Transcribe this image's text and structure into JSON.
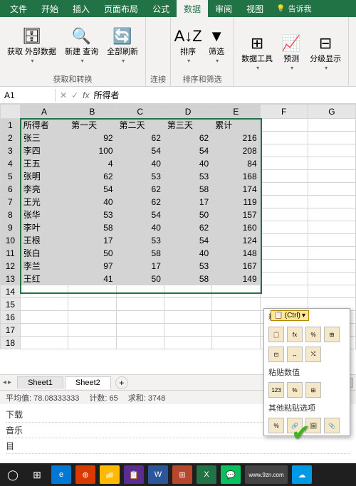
{
  "menubar": {
    "tabs": [
      "文件",
      "开始",
      "插入",
      "页面布局",
      "公式",
      "数据",
      "审阅",
      "视图"
    ],
    "active_index": 5,
    "tellme": "告诉我"
  },
  "ribbon": {
    "groups": [
      {
        "id": "get",
        "label": "获取和转换",
        "items": [
          {
            "icon": "🗄",
            "lbl": "获取\n外部数据"
          },
          {
            "icon": "🔍",
            "lbl": "新建\n查询"
          },
          {
            "icon": "🔄",
            "lbl": "全部刷新"
          }
        ]
      },
      {
        "id": "conn",
        "label": "连接",
        "items": []
      },
      {
        "id": "sort",
        "label": "排序和筛选",
        "items": [
          {
            "icon": "A↓Z",
            "lbl": "排序"
          },
          {
            "icon": "▼",
            "lbl": "筛选"
          }
        ]
      },
      {
        "id": "tools",
        "label": "",
        "items": [
          {
            "icon": "⊞",
            "lbl": "数据工具"
          },
          {
            "icon": "📈",
            "lbl": "预测"
          },
          {
            "icon": "⊟",
            "lbl": "分级显示"
          }
        ]
      }
    ]
  },
  "namebox": {
    "ref": "A1",
    "formula": "所得者"
  },
  "columns": [
    "A",
    "B",
    "C",
    "D",
    "E",
    "F",
    "G"
  ],
  "row_count": 18,
  "selected_cols": 5,
  "selected_rows": 13,
  "chart_data": {
    "type": "table",
    "headers": [
      "所得者",
      "第一天",
      "第二天",
      "第三天",
      "累计"
    ],
    "rows": [
      [
        "张三",
        92,
        62,
        62,
        216
      ],
      [
        "李四",
        100,
        54,
        54,
        208
      ],
      [
        "王五",
        4,
        40,
        40,
        84
      ],
      [
        "张明",
        62,
        53,
        53,
        168
      ],
      [
        "李亮",
        54,
        62,
        58,
        174
      ],
      [
        "王光",
        40,
        62,
        17,
        119
      ],
      [
        "张华",
        53,
        54,
        50,
        157
      ],
      [
        "李叶",
        58,
        40,
        62,
        160
      ],
      [
        "王根",
        17,
        53,
        54,
        124
      ],
      [
        "张白",
        50,
        58,
        40,
        148
      ],
      [
        "李兰",
        97,
        17,
        53,
        167
      ],
      [
        "王红",
        41,
        50,
        58,
        149
      ]
    ]
  },
  "paste_ctrl_label": "(Ctrl)",
  "paste_popup": {
    "sections": [
      {
        "title": "粘贴",
        "icons": [
          "paste",
          "fx",
          "%fx",
          "src",
          "noborder",
          "keepwidth",
          "transpose"
        ]
      },
      {
        "title": "粘贴数值",
        "icons": [
          "123",
          "%123",
          "src123"
        ]
      },
      {
        "title": "其他粘贴选项",
        "icons": [
          "fmt",
          "link",
          "pic",
          "linkpic"
        ]
      }
    ]
  },
  "sheets": {
    "tabs": [
      "Sheet1",
      "Sheet2"
    ],
    "active_index": 1
  },
  "statusbar": {
    "avg_label": "平均值:",
    "avg": "78.08333333",
    "count_label": "计数:",
    "count": "65",
    "sum_label": "求和:",
    "sum": "3748"
  },
  "desktop_items": [
    "下载",
    "音乐",
    "目"
  ],
  "watermark": "www.9zn.com"
}
